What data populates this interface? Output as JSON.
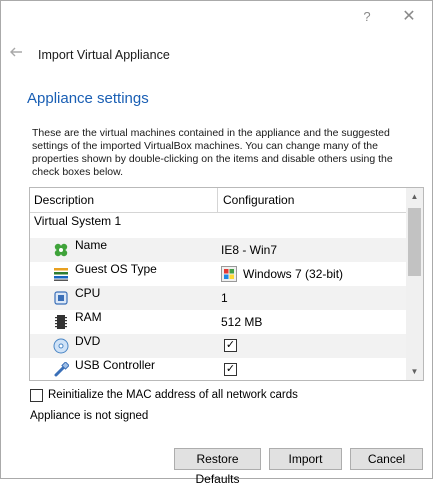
{
  "titlebar": {
    "help_label": "?",
    "close_label": "✕"
  },
  "wizard": {
    "back_label": "🡐",
    "title": "Import Virtual Appliance"
  },
  "page": {
    "heading": "Appliance settings",
    "description": "These are the virtual machines contained in the appliance and the suggested settings of the imported VirtualBox machines. You can change many of the properties shown by double-clicking on the items and disable others using the check boxes below."
  },
  "table": {
    "columns": [
      "Description",
      "Configuration"
    ],
    "group": "Virtual System 1",
    "rows": [
      {
        "icon": "name-icon",
        "label": "Name",
        "value": "IE8 - Win7",
        "type": "text"
      },
      {
        "icon": "guest-os-icon",
        "label": "Guest OS Type",
        "value": "Windows 7 (32-bit)",
        "type": "os"
      },
      {
        "icon": "cpu-icon",
        "label": "CPU",
        "value": "1",
        "type": "text"
      },
      {
        "icon": "ram-icon",
        "label": "RAM",
        "value": "512 MB",
        "type": "text"
      },
      {
        "icon": "dvd-icon",
        "label": "DVD",
        "value": "✓",
        "checked": true,
        "type": "check"
      },
      {
        "icon": "usb-icon",
        "label": "USB Controller",
        "value": "✓",
        "checked": true,
        "type": "check"
      }
    ]
  },
  "options": {
    "mac_label": "Reinitialize the MAC address of all network cards",
    "mac_checked": false,
    "signed_status": "Appliance is not signed"
  },
  "buttons": {
    "restore": "Restore Defaults",
    "import": "Import",
    "cancel": "Cancel"
  },
  "colors": {
    "heading": "#1a5fb4",
    "button_bg": "#e1e1e1",
    "alt_row": "#f2f2f2"
  }
}
